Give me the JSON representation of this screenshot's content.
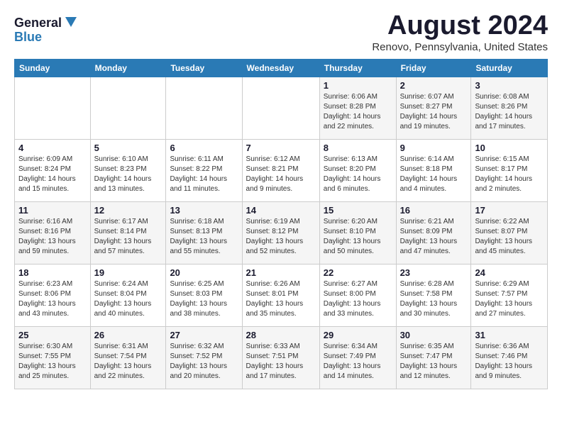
{
  "header": {
    "logo_general": "General",
    "logo_blue": "Blue",
    "month_title": "August 2024",
    "location": "Renovo, Pennsylvania, United States"
  },
  "weekdays": [
    "Sunday",
    "Monday",
    "Tuesday",
    "Wednesday",
    "Thursday",
    "Friday",
    "Saturday"
  ],
  "weeks": [
    [
      {
        "day": "",
        "info": ""
      },
      {
        "day": "",
        "info": ""
      },
      {
        "day": "",
        "info": ""
      },
      {
        "day": "",
        "info": ""
      },
      {
        "day": "1",
        "info": "Sunrise: 6:06 AM\nSunset: 8:28 PM\nDaylight: 14 hours\nand 22 minutes."
      },
      {
        "day": "2",
        "info": "Sunrise: 6:07 AM\nSunset: 8:27 PM\nDaylight: 14 hours\nand 19 minutes."
      },
      {
        "day": "3",
        "info": "Sunrise: 6:08 AM\nSunset: 8:26 PM\nDaylight: 14 hours\nand 17 minutes."
      }
    ],
    [
      {
        "day": "4",
        "info": "Sunrise: 6:09 AM\nSunset: 8:24 PM\nDaylight: 14 hours\nand 15 minutes."
      },
      {
        "day": "5",
        "info": "Sunrise: 6:10 AM\nSunset: 8:23 PM\nDaylight: 14 hours\nand 13 minutes."
      },
      {
        "day": "6",
        "info": "Sunrise: 6:11 AM\nSunset: 8:22 PM\nDaylight: 14 hours\nand 11 minutes."
      },
      {
        "day": "7",
        "info": "Sunrise: 6:12 AM\nSunset: 8:21 PM\nDaylight: 14 hours\nand 9 minutes."
      },
      {
        "day": "8",
        "info": "Sunrise: 6:13 AM\nSunset: 8:20 PM\nDaylight: 14 hours\nand 6 minutes."
      },
      {
        "day": "9",
        "info": "Sunrise: 6:14 AM\nSunset: 8:18 PM\nDaylight: 14 hours\nand 4 minutes."
      },
      {
        "day": "10",
        "info": "Sunrise: 6:15 AM\nSunset: 8:17 PM\nDaylight: 14 hours\nand 2 minutes."
      }
    ],
    [
      {
        "day": "11",
        "info": "Sunrise: 6:16 AM\nSunset: 8:16 PM\nDaylight: 13 hours\nand 59 minutes."
      },
      {
        "day": "12",
        "info": "Sunrise: 6:17 AM\nSunset: 8:14 PM\nDaylight: 13 hours\nand 57 minutes."
      },
      {
        "day": "13",
        "info": "Sunrise: 6:18 AM\nSunset: 8:13 PM\nDaylight: 13 hours\nand 55 minutes."
      },
      {
        "day": "14",
        "info": "Sunrise: 6:19 AM\nSunset: 8:12 PM\nDaylight: 13 hours\nand 52 minutes."
      },
      {
        "day": "15",
        "info": "Sunrise: 6:20 AM\nSunset: 8:10 PM\nDaylight: 13 hours\nand 50 minutes."
      },
      {
        "day": "16",
        "info": "Sunrise: 6:21 AM\nSunset: 8:09 PM\nDaylight: 13 hours\nand 47 minutes."
      },
      {
        "day": "17",
        "info": "Sunrise: 6:22 AM\nSunset: 8:07 PM\nDaylight: 13 hours\nand 45 minutes."
      }
    ],
    [
      {
        "day": "18",
        "info": "Sunrise: 6:23 AM\nSunset: 8:06 PM\nDaylight: 13 hours\nand 43 minutes."
      },
      {
        "day": "19",
        "info": "Sunrise: 6:24 AM\nSunset: 8:04 PM\nDaylight: 13 hours\nand 40 minutes."
      },
      {
        "day": "20",
        "info": "Sunrise: 6:25 AM\nSunset: 8:03 PM\nDaylight: 13 hours\nand 38 minutes."
      },
      {
        "day": "21",
        "info": "Sunrise: 6:26 AM\nSunset: 8:01 PM\nDaylight: 13 hours\nand 35 minutes."
      },
      {
        "day": "22",
        "info": "Sunrise: 6:27 AM\nSunset: 8:00 PM\nDaylight: 13 hours\nand 33 minutes."
      },
      {
        "day": "23",
        "info": "Sunrise: 6:28 AM\nSunset: 7:58 PM\nDaylight: 13 hours\nand 30 minutes."
      },
      {
        "day": "24",
        "info": "Sunrise: 6:29 AM\nSunset: 7:57 PM\nDaylight: 13 hours\nand 27 minutes."
      }
    ],
    [
      {
        "day": "25",
        "info": "Sunrise: 6:30 AM\nSunset: 7:55 PM\nDaylight: 13 hours\nand 25 minutes."
      },
      {
        "day": "26",
        "info": "Sunrise: 6:31 AM\nSunset: 7:54 PM\nDaylight: 13 hours\nand 22 minutes."
      },
      {
        "day": "27",
        "info": "Sunrise: 6:32 AM\nSunset: 7:52 PM\nDaylight: 13 hours\nand 20 minutes."
      },
      {
        "day": "28",
        "info": "Sunrise: 6:33 AM\nSunset: 7:51 PM\nDaylight: 13 hours\nand 17 minutes."
      },
      {
        "day": "29",
        "info": "Sunrise: 6:34 AM\nSunset: 7:49 PM\nDaylight: 13 hours\nand 14 minutes."
      },
      {
        "day": "30",
        "info": "Sunrise: 6:35 AM\nSunset: 7:47 PM\nDaylight: 13 hours\nand 12 minutes."
      },
      {
        "day": "31",
        "info": "Sunrise: 6:36 AM\nSunset: 7:46 PM\nDaylight: 13 hours\nand 9 minutes."
      }
    ]
  ]
}
